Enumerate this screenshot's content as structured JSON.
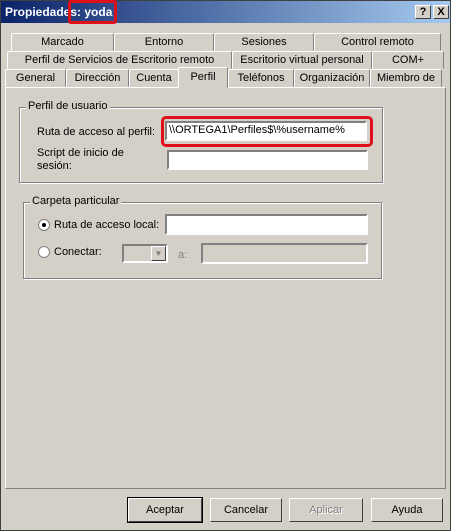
{
  "window": {
    "title": "Propiedades: yoda",
    "help_button": "?",
    "close_button": "X"
  },
  "tabs": {
    "row1": [
      "Marcado",
      "Entorno",
      "Sesiones",
      "Control remoto"
    ],
    "row2": [
      "Perfil de Servicios de Escritorio remoto",
      "Escritorio virtual personal",
      "COM+"
    ],
    "row3": [
      "General",
      "Dirección",
      "Cuenta",
      "Perfil",
      "Teléfonos",
      "Organización",
      "Miembro de"
    ],
    "selected": "Perfil"
  },
  "user_profile": {
    "group_label": "Perfil de usuario",
    "profile_path_label": "Ruta de acceso al perfil:",
    "profile_path_value": "\\\\ORTEGA1\\Perfiles$\\%username%",
    "logon_script_label_line1": "Script de inicio de",
    "logon_script_label_line2": "sesión:",
    "logon_script_value": ""
  },
  "home_folder": {
    "group_label": "Carpeta particular",
    "local_path_label": "Ruta de acceso local:",
    "local_path_value": "",
    "connect_label": "Conectar:",
    "connect_to_label": "a:",
    "selected_option": "local"
  },
  "buttons": {
    "accept": "Aceptar",
    "cancel": "Cancelar",
    "apply": "Aplicar",
    "help": "Ayuda"
  },
  "colors": {
    "highlight": "#e0101a",
    "titlebar_start": "#0a246a",
    "titlebar_end": "#a6caf0",
    "face": "#d4d0c8"
  }
}
